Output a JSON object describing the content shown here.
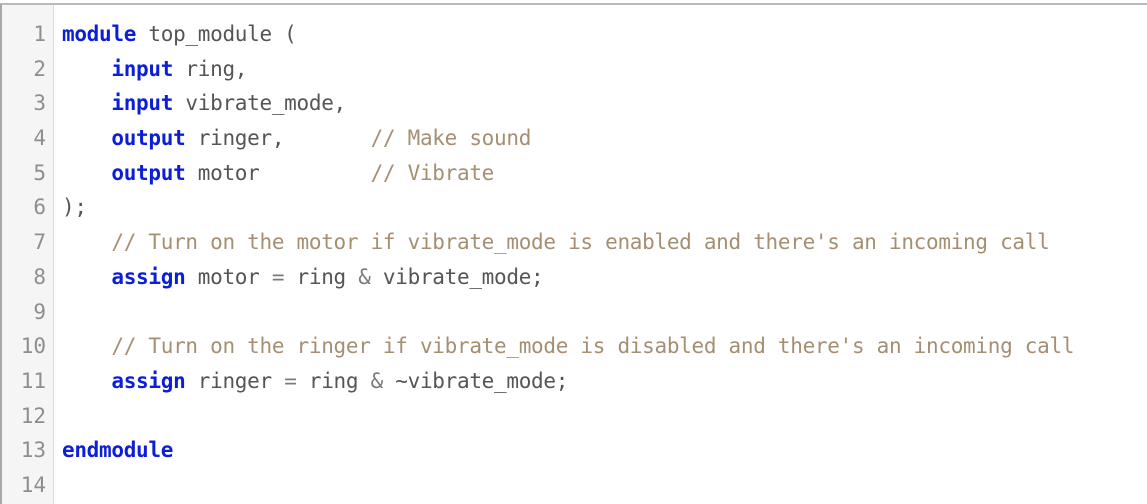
{
  "editor": {
    "lines": [
      {
        "num": "1",
        "tokens": [
          {
            "t": "kw",
            "v": "module"
          },
          {
            "t": "tx",
            "v": " top_module ("
          }
        ]
      },
      {
        "num": "2",
        "tokens": [
          {
            "t": "tx",
            "v": "    "
          },
          {
            "t": "kw",
            "v": "input"
          },
          {
            "t": "tx",
            "v": " ring,"
          }
        ]
      },
      {
        "num": "3",
        "tokens": [
          {
            "t": "tx",
            "v": "    "
          },
          {
            "t": "kw",
            "v": "input"
          },
          {
            "t": "tx",
            "v": " vibrate_mode,"
          }
        ]
      },
      {
        "num": "4",
        "tokens": [
          {
            "t": "tx",
            "v": "    "
          },
          {
            "t": "kw",
            "v": "output"
          },
          {
            "t": "tx",
            "v": " ringer,       "
          },
          {
            "t": "cm",
            "v": "// Make sound"
          }
        ]
      },
      {
        "num": "5",
        "tokens": [
          {
            "t": "tx",
            "v": "    "
          },
          {
            "t": "kw",
            "v": "output"
          },
          {
            "t": "tx",
            "v": " motor         "
          },
          {
            "t": "cm",
            "v": "// Vibrate"
          }
        ]
      },
      {
        "num": "6",
        "tokens": [
          {
            "t": "tx",
            "v": ");"
          }
        ]
      },
      {
        "num": "7",
        "tokens": [
          {
            "t": "tx",
            "v": "    "
          },
          {
            "t": "cm",
            "v": "// Turn on the motor if vibrate_mode is enabled and there's an incoming call"
          }
        ]
      },
      {
        "num": "8",
        "tokens": [
          {
            "t": "tx",
            "v": "    "
          },
          {
            "t": "kw",
            "v": "assign"
          },
          {
            "t": "tx",
            "v": " motor "
          },
          {
            "t": "op",
            "v": "="
          },
          {
            "t": "tx",
            "v": " ring "
          },
          {
            "t": "op",
            "v": "&"
          },
          {
            "t": "tx",
            "v": " vibrate_mode;"
          }
        ]
      },
      {
        "num": "9",
        "tokens": []
      },
      {
        "num": "10",
        "tokens": [
          {
            "t": "tx",
            "v": "    "
          },
          {
            "t": "cm",
            "v": "// Turn on the ringer if vibrate_mode is disabled and there's an incoming call"
          }
        ]
      },
      {
        "num": "11",
        "tokens": [
          {
            "t": "tx",
            "v": "    "
          },
          {
            "t": "kw",
            "v": "assign"
          },
          {
            "t": "tx",
            "v": " ringer "
          },
          {
            "t": "op",
            "v": "="
          },
          {
            "t": "tx",
            "v": " ring "
          },
          {
            "t": "op",
            "v": "&"
          },
          {
            "t": "tx",
            "v": " ~vibrate_mode;"
          }
        ]
      },
      {
        "num": "12",
        "tokens": []
      },
      {
        "num": "13",
        "tokens": [
          {
            "t": "kw",
            "v": "endmodule"
          }
        ]
      },
      {
        "num": "14",
        "tokens": []
      }
    ]
  },
  "colors": {
    "keyword": "#0d1fd6",
    "comment": "#a58f73",
    "text": "#555555",
    "line_number": "#8e8e8e",
    "gutter_bg": "#f5f5f5"
  }
}
